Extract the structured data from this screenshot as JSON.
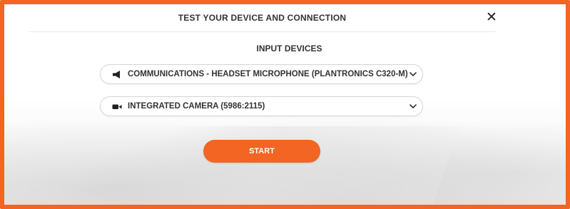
{
  "dialog": {
    "title": "TEST YOUR DEVICE AND CONNECTION",
    "close_icon": "close-icon"
  },
  "input_devices": {
    "heading": "INPUT DEVICES",
    "microphone": {
      "icon": "speaker-icon",
      "selected": "COMMUNICATIONS - HEADSET MICROPHONE (PLANTRONICS C320-M)"
    },
    "camera": {
      "icon": "camera-icon",
      "selected": "INTEGRATED CAMERA (5986:2115)"
    }
  },
  "actions": {
    "start_label": "START"
  },
  "colors": {
    "accent": "#f26522",
    "text": "#333333"
  }
}
